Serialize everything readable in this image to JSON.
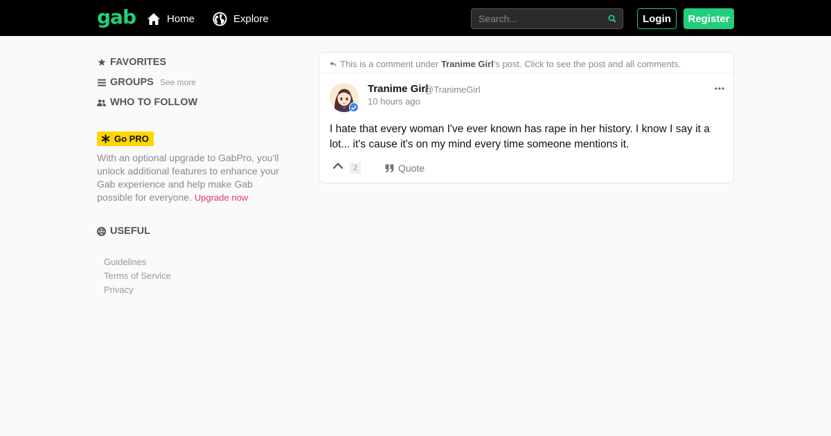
{
  "brand": {
    "logo": "gab",
    "accent_color": "#21cf7a"
  },
  "topnav": {
    "items": [
      {
        "label": "Home",
        "icon": "home-icon"
      },
      {
        "label": "Explore",
        "icon": "globe-icon"
      }
    ],
    "search_placeholder": "Search...",
    "login_label": "Login",
    "register_label": "Register"
  },
  "sidebar": {
    "favorites_label": "FAVORITES",
    "groups_label": "GROUPS",
    "groups_see_more": "See more",
    "who_to_follow_label": "WHO TO FOLLOW",
    "gopro_label": "Go PRO",
    "gopro_text": "With an optional upgrade to GabPro, you'll unlock additional features to enhance your Gab experience and help make Gab possible for everyone.",
    "upgrade_link": "Upgrade now",
    "useful_label": "USEFUL",
    "footer_links": [
      "Guidelines",
      "Terms of Service",
      "Privacy"
    ]
  },
  "post": {
    "comment_prefix": "This is a comment under",
    "comment_author": "Tranime Girl",
    "comment_suffix": "'s post. Click to see the post and all comments.",
    "author_name": "Tranime Girl",
    "author_handle": "@TranimeGirl",
    "time": "10 hours ago",
    "body": "I hate that every woman I've ever known has rape in her history. I know I say it a lot... it's cause it's on my mind every time someone mentions it.",
    "vote_count": "2",
    "quote_label": "Quote"
  }
}
